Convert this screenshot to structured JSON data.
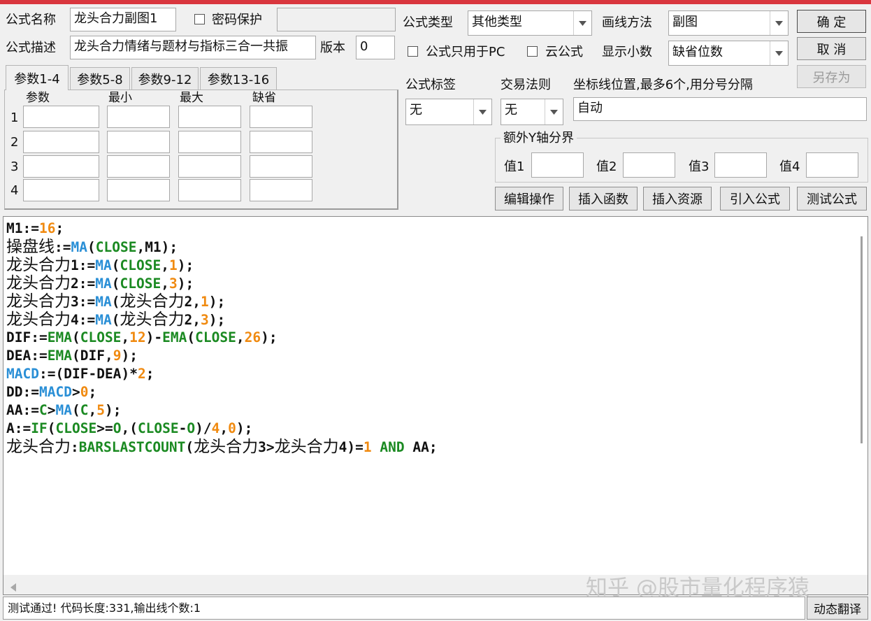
{
  "formula": {
    "name_label": "公式名称",
    "name_value": "龙头合力副图1",
    "password_label": "密码保护",
    "desc_label": "公式描述",
    "desc_value": "龙头合力情绪与题材与指标三合一共振",
    "version_label": "版本",
    "version_value": "0",
    "type_label": "公式类型",
    "type_value": "其他类型",
    "draw_label": "画线方法",
    "draw_value": "副图",
    "pc_only_label": "公式只用于PC",
    "cloud_label": "云公式",
    "decimal_label": "显示小数",
    "decimal_value": "缺省位数",
    "tag_label": "公式标签",
    "tag_value": "无",
    "rule_label": "交易法则",
    "rule_value": "无",
    "coord_label": "坐标线位置,最多6个,用分号分隔",
    "coord_value": "自动",
    "yaxis_label": "额外Y轴分界",
    "y_values": [
      "值1",
      "值2",
      "值3",
      "值4"
    ]
  },
  "buttons": {
    "ok": "确 定",
    "cancel": "取 消",
    "save_as": "另存为",
    "edit": "编辑操作",
    "insert_func": "插入函数",
    "insert_res": "插入资源",
    "import": "引入公式",
    "test": "测试公式",
    "translate": "动态翻译"
  },
  "params": {
    "tabs": [
      "参数1-4",
      "参数5-8",
      "参数9-12",
      "参数13-16"
    ],
    "headers": [
      "参数",
      "最小",
      "最大",
      "缺省"
    ],
    "rows": [
      "1",
      "2",
      "3",
      "4"
    ]
  },
  "code_lines": [
    "M1:=16;",
    "操盘线:=MA(CLOSE,M1);",
    "龙头合力1:=MA(CLOSE,1);",
    "龙头合力2:=MA(CLOSE,3);",
    "龙头合力3:=MA(龙头合力2,1);",
    "龙头合力4:=MA(龙头合力2,3);",
    "DIF:=EMA(CLOSE,12)-EMA(CLOSE,26);",
    "DEA:=EMA(DIF,9);",
    "MACD:=(DIF-DEA)*2;",
    "DD:=MACD>0;",
    "AA:=C>MA(C,5);",
    "A:=IF(CLOSE>=O,(CLOSE-O)/4,0);",
    "龙头合力:BARSLASTCOUNT(龙头合力3>龙头合力4)=1 AND AA;"
  ],
  "status": "测试通过! 代码长度:331,输出线个数:1",
  "watermark": "知乎 @股市量化程序猿",
  "colors": {
    "keyword_green": "#1b8a22",
    "function_blue": "#2a8fd6",
    "number_orange": "#f08a10",
    "text_dark": "#111111",
    "top_bar": "#d9363e"
  },
  "icons": [
    "dropdown-arrow-icon",
    "scroll-left-arrow-icon"
  ]
}
